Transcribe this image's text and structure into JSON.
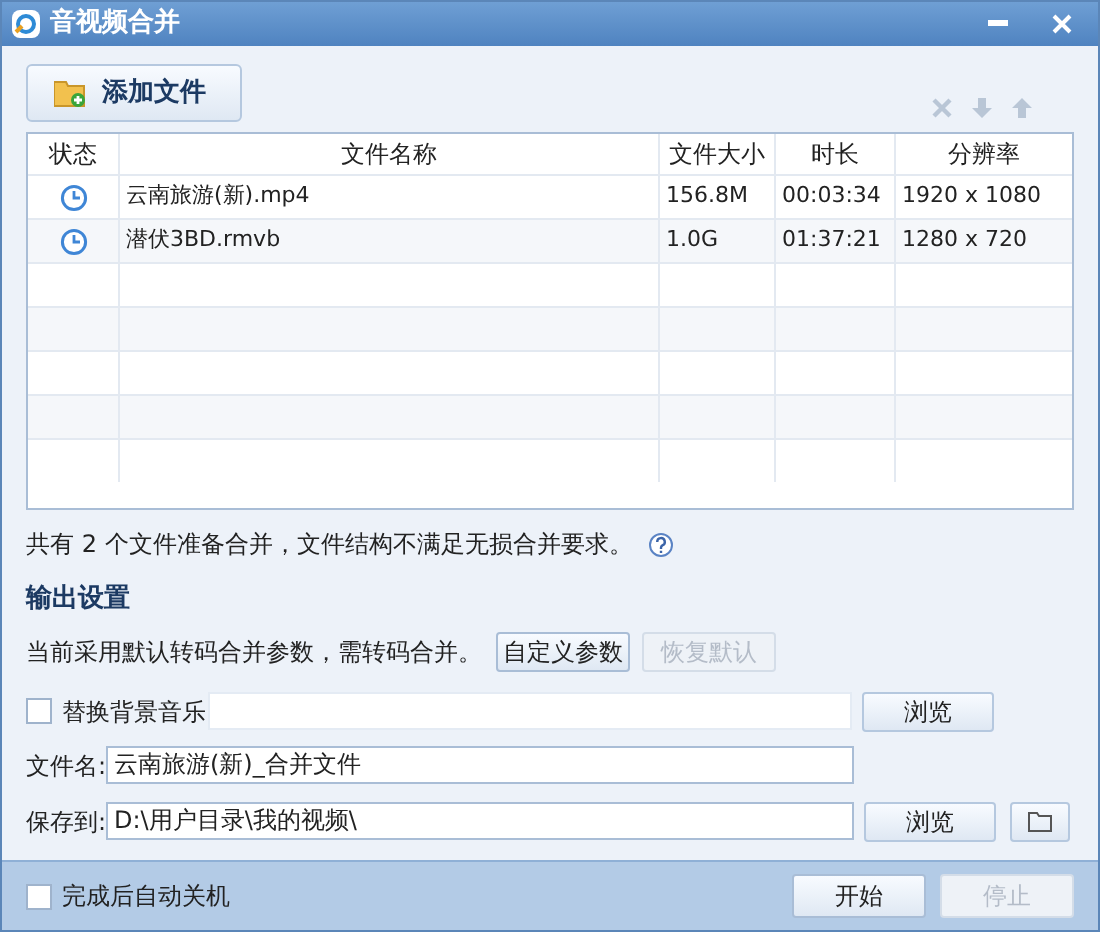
{
  "window": {
    "title": "音视频合并"
  },
  "add_button": {
    "label": "添加文件"
  },
  "toolbar": [
    {
      "kind": "remove",
      "disabled": true
    },
    {
      "kind": "down",
      "disabled": true
    },
    {
      "kind": "up",
      "disabled": true
    }
  ],
  "table": {
    "columns": [
      "状态",
      "文件名称",
      "文件大小",
      "时长",
      "分辨率"
    ],
    "rows": [
      {
        "kind": "waiting",
        "name": "云南旅游(新).mp4",
        "size": "156.8M",
        "duration": "00:03:34",
        "resolution": "1920 x 1080"
      },
      {
        "kind": "waiting",
        "name": "潜伏3BD.rmvb",
        "size": "1.0G",
        "duration": "01:37:21",
        "resolution": "1280 x 720"
      }
    ]
  },
  "summary": "共有 2 个文件准备合并，文件结构不满足无损合并要求。",
  "output": {
    "heading": "输出设置",
    "note": "当前采用默认转码合并参数，需转码合并。",
    "buttons": [
      {
        "label": "自定义参数",
        "disabled": false
      },
      {
        "label": "恢复默认",
        "disabled": true
      }
    ],
    "music": {
      "label": "替换背景音乐",
      "checked": false,
      "browse": "浏览"
    },
    "filename": {
      "label": "文件名:",
      "value": "云南旅游(新)_合并文件"
    },
    "save_to": {
      "label": "保存到:",
      "value": "D:\\用户目录\\我的视频\\",
      "browse": "浏览"
    }
  },
  "footer": {
    "shutdown": {
      "label": "完成后自动关机",
      "checked": false
    },
    "buttons": [
      {
        "label": "开始",
        "disabled": false
      },
      {
        "label": "停止",
        "disabled": true
      }
    ]
  }
}
